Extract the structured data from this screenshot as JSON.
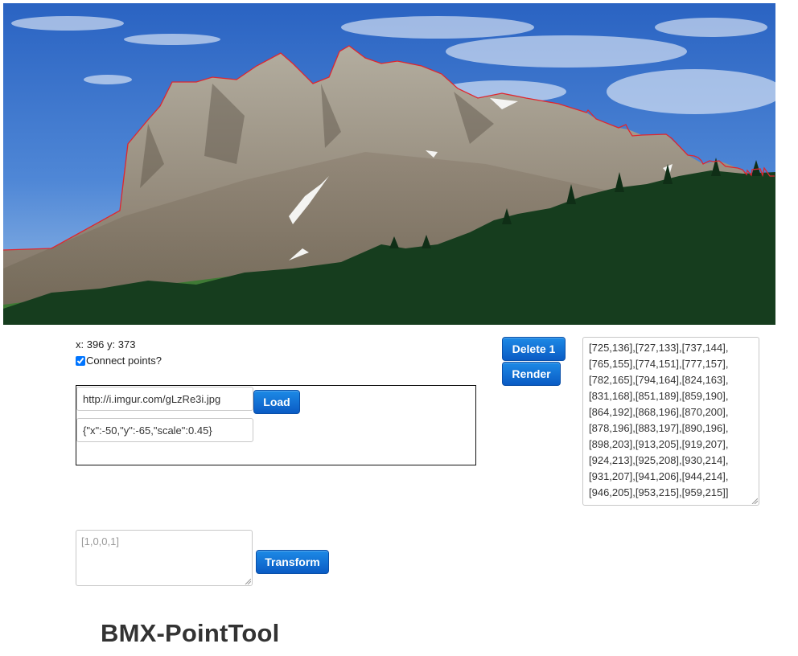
{
  "photo": {
    "description_icon": "mountain-photo",
    "colors": {
      "sky_top": "#2a63c2",
      "sky_bottom": "#9cc0e8",
      "rock": "#a8a294",
      "forest": "#163d1e",
      "grass": "#3f7a35",
      "outline": "#e0262e"
    }
  },
  "cursor": {
    "label": "x: 396 y: 373"
  },
  "connect": {
    "label": "Connect points?",
    "checked": true
  },
  "load": {
    "url_value": "http://i.imgur.com/gLzRe3i.jpg",
    "options_value": "{\"x\":-50,\"y\":-65,\"scale\":0.45}",
    "button_label": "Load"
  },
  "actions": {
    "delete_label": "Delete 1",
    "render_label": "Render"
  },
  "points": {
    "lines": [
      "[725,136],[727,133],[737,144],",
      "[765,155],[774,151],[777,157],",
      "[782,165],[794,164],[824,163],",
      "[831,168],[851,189],[859,190],",
      "[864,192],[868,196],[870,200],",
      "[878,196],[883,197],[890,196],",
      "[898,203],[913,205],[919,207],",
      "[924,213],[925,208],[930,214],",
      "[931,207],[941,206],[944,214],",
      "[946,205],[953,215],[959,215]]"
    ]
  },
  "transform": {
    "placeholder": "[1,0,0,1]",
    "button_label": "Transform"
  },
  "page": {
    "title": "BMX-PointTool"
  }
}
